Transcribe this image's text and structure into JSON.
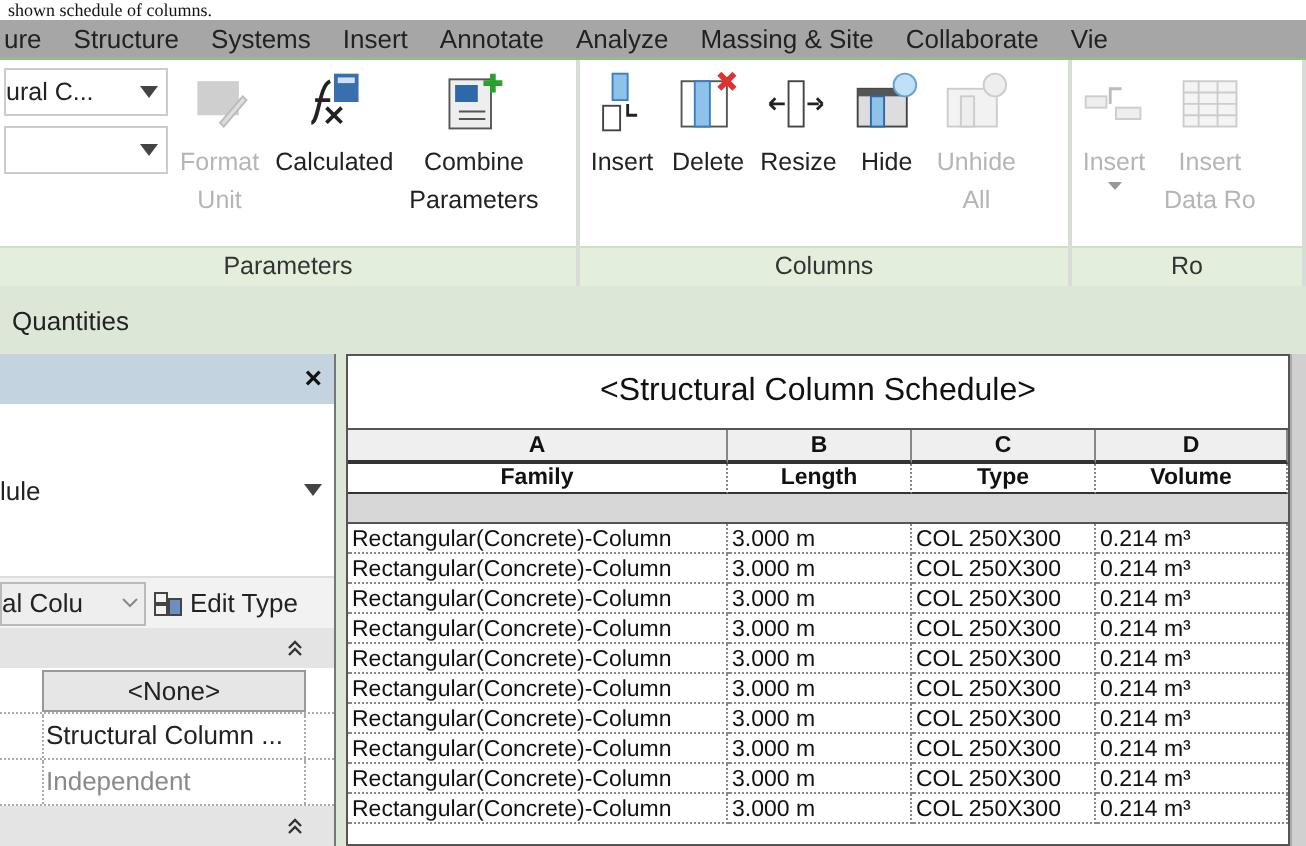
{
  "caption": "shown schedule of columns.",
  "menu_tabs": [
    {
      "label": "ure",
      "selected": false
    },
    {
      "label": "Structure",
      "selected": false
    },
    {
      "label": "Systems",
      "selected": false
    },
    {
      "label": "Insert",
      "selected": false
    },
    {
      "label": "Annotate",
      "selected": false
    },
    {
      "label": "Analyze",
      "selected": false
    },
    {
      "label": "Massing & Site",
      "selected": false
    },
    {
      "label": "Collaborate",
      "selected": false
    },
    {
      "label": "Vie",
      "selected": false
    }
  ],
  "ribbon": {
    "family_dropdown": {
      "value": "ural C..."
    },
    "panels": [
      {
        "label": "Parameters",
        "buttons": [
          {
            "lines": [
              "Format",
              "Unit"
            ],
            "disabled": true,
            "has_menu": false
          },
          {
            "lines": [
              "Calculated"
            ],
            "disabled": false,
            "has_menu": false
          },
          {
            "lines": [
              "Combine",
              "Parameters"
            ],
            "disabled": false,
            "has_menu": false
          }
        ]
      },
      {
        "label": "Columns",
        "buttons": [
          {
            "lines": [
              "Insert"
            ],
            "disabled": false,
            "has_menu": false
          },
          {
            "lines": [
              "Delete"
            ],
            "disabled": false,
            "has_menu": false
          },
          {
            "lines": [
              "Resize"
            ],
            "disabled": false,
            "has_menu": false
          },
          {
            "lines": [
              "Hide"
            ],
            "disabled": false,
            "has_menu": false
          },
          {
            "lines": [
              "Unhide",
              "All"
            ],
            "disabled": true,
            "has_menu": false
          }
        ]
      },
      {
        "label": "Ro",
        "buttons": [
          {
            "lines": [
              "Insert"
            ],
            "disabled": true,
            "has_menu": true
          },
          {
            "lines": [
              "Insert",
              "Data Ro"
            ],
            "disabled": true,
            "has_menu": false
          }
        ]
      }
    ]
  },
  "view_bar": {
    "label": "Quantities"
  },
  "properties": {
    "close": "×",
    "type_value": "lule",
    "type_selector": "al Colu",
    "edit_type": "Edit Type",
    "rows": [
      {
        "kind": "button",
        "value": "<None>",
        "disabled": false
      },
      {
        "kind": "text",
        "value": "Structural Column ...",
        "disabled": false
      },
      {
        "kind": "text",
        "value": "Independent",
        "disabled": true
      }
    ]
  },
  "schedule": {
    "title": "<Structural Column Schedule>",
    "columns": [
      {
        "letter": "A",
        "name": "Family"
      },
      {
        "letter": "B",
        "name": "Length"
      },
      {
        "letter": "C",
        "name": "Type"
      },
      {
        "letter": "D",
        "name": "Volume"
      }
    ],
    "rows": [
      {
        "family": "Rectangular(Concrete)-Column",
        "length": "3.000 m",
        "type": "COL 250X300",
        "volume": "0.214 m³"
      },
      {
        "family": "Rectangular(Concrete)-Column",
        "length": "3.000 m",
        "type": "COL 250X300",
        "volume": "0.214 m³"
      },
      {
        "family": "Rectangular(Concrete)-Column",
        "length": "3.000 m",
        "type": "COL 250X300",
        "volume": "0.214 m³"
      },
      {
        "family": "Rectangular(Concrete)-Column",
        "length": "3.000 m",
        "type": "COL 250X300",
        "volume": "0.214 m³"
      },
      {
        "family": "Rectangular(Concrete)-Column",
        "length": "3.000 m",
        "type": "COL 250X300",
        "volume": "0.214 m³"
      },
      {
        "family": "Rectangular(Concrete)-Column",
        "length": "3.000 m",
        "type": "COL 250X300",
        "volume": "0.214 m³"
      },
      {
        "family": "Rectangular(Concrete)-Column",
        "length": "3.000 m",
        "type": "COL 250X300",
        "volume": "0.214 m³"
      },
      {
        "family": "Rectangular(Concrete)-Column",
        "length": "3.000 m",
        "type": "COL 250X300",
        "volume": "0.214 m³"
      },
      {
        "family": "Rectangular(Concrete)-Column",
        "length": "3.000 m",
        "type": "COL 250X300",
        "volume": "0.214 m³"
      },
      {
        "family": "Rectangular(Concrete)-Column",
        "length": "3.000 m",
        "type": "COL 250X300",
        "volume": "0.214 m³"
      }
    ]
  }
}
